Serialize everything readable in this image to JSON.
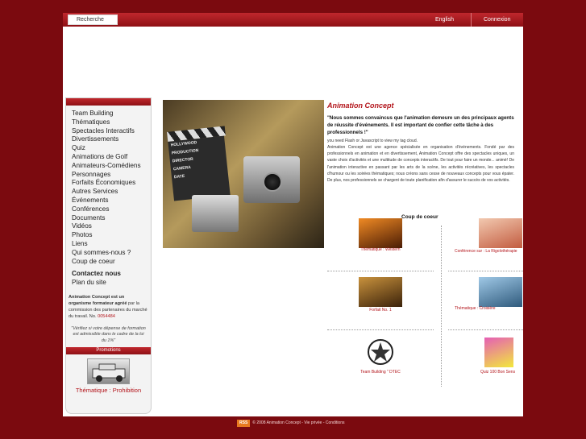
{
  "header": {
    "search_placeholder": "Recherche",
    "language": "English",
    "login": "Connexion"
  },
  "sidebar": {
    "menu": [
      "Team Building",
      "Thématiques",
      "Spectacles Interactifs",
      "Divertissements",
      "Quiz",
      "Animations de Golf",
      "Animateurs-Comédiens",
      "Personnages",
      "Forfaits Économiques",
      "Autres Services",
      "Événements",
      "Conférences",
      "Documents",
      "Vidéos",
      "Photos",
      "Liens",
      "Qui sommes-nous ?",
      "Coup de coeur"
    ],
    "contact": "Contactez nous",
    "sitemap": "Plan du site",
    "agree_bold": "Animation Concept est un organisme formateur agréé",
    "agree_text": "par la commission des partenaires du marché du travail. No.",
    "agree_number": "0054484",
    "note": "\"Vérifiez si votre dépense de formation est admissible dans le cadre de la loi du 1%\"",
    "promo_head": "Promotions",
    "promo_caption": "Thématique : Prohibition"
  },
  "hero": {
    "clap_lines": [
      "HOLLYWOOD",
      "PRODUCTION",
      "DIRECTOR",
      "CAMERA",
      "DATE"
    ]
  },
  "content": {
    "title": "Animation Concept",
    "quote": "\"Nous sommes convaincus que l'animation demeure un des principaux agents de réussite d'événements. Il est important de confier cette tâche à des professionnels !\"",
    "flash_note": "you need Flash or Javascript to view my tag cloud.",
    "body": "Animation Concept est une agence spécialisée en organisation d'événements. Fondé par des professionnels en animation et en divertissement, Animation Concept offre des spectacles uniques, un vaste choix d'activités et une multitude de concepts interactifs. De tout pour faire un monde... animé! De l'animation interactive en passant par les arts de la scène, les activités récréatives, les spectacles d'humour ou les soirées thématiques; nous créons sans cesse de nouveaux concepts pour vous épater. De plus, nos professionnels se chargent de toute planification afin d'assurer le succès de vos activités."
  },
  "coup": {
    "title": "Coup de coeur",
    "items": [
      {
        "caption": "Thématique : Western",
        "color_a": "#f08a24",
        "color_b": "#4a1c05"
      },
      {
        "caption": "Conférence sur : La Rigolothérapie",
        "color_a": "#f2c9b0",
        "color_b": "#c25b3f"
      },
      {
        "caption": "Forfait No. 1",
        "color_a": "#c9923d",
        "color_b": "#3b220a"
      },
      {
        "caption": "Thématique : Croisière",
        "color_a": "#9fc8e6",
        "color_b": "#2f5a7c"
      },
      {
        "caption": "Team Building \" DTEC",
        "color_a": "#ffffff",
        "color_b": "#2b2b2b"
      },
      {
        "caption": "Quiz 100 Bon Sens",
        "color_a": "#e55fb5",
        "color_b": "#f2e93c"
      }
    ]
  },
  "footer": {
    "rss": "RSS",
    "text": "© 2008 Animation Concept - Vie privée - Conditions"
  }
}
